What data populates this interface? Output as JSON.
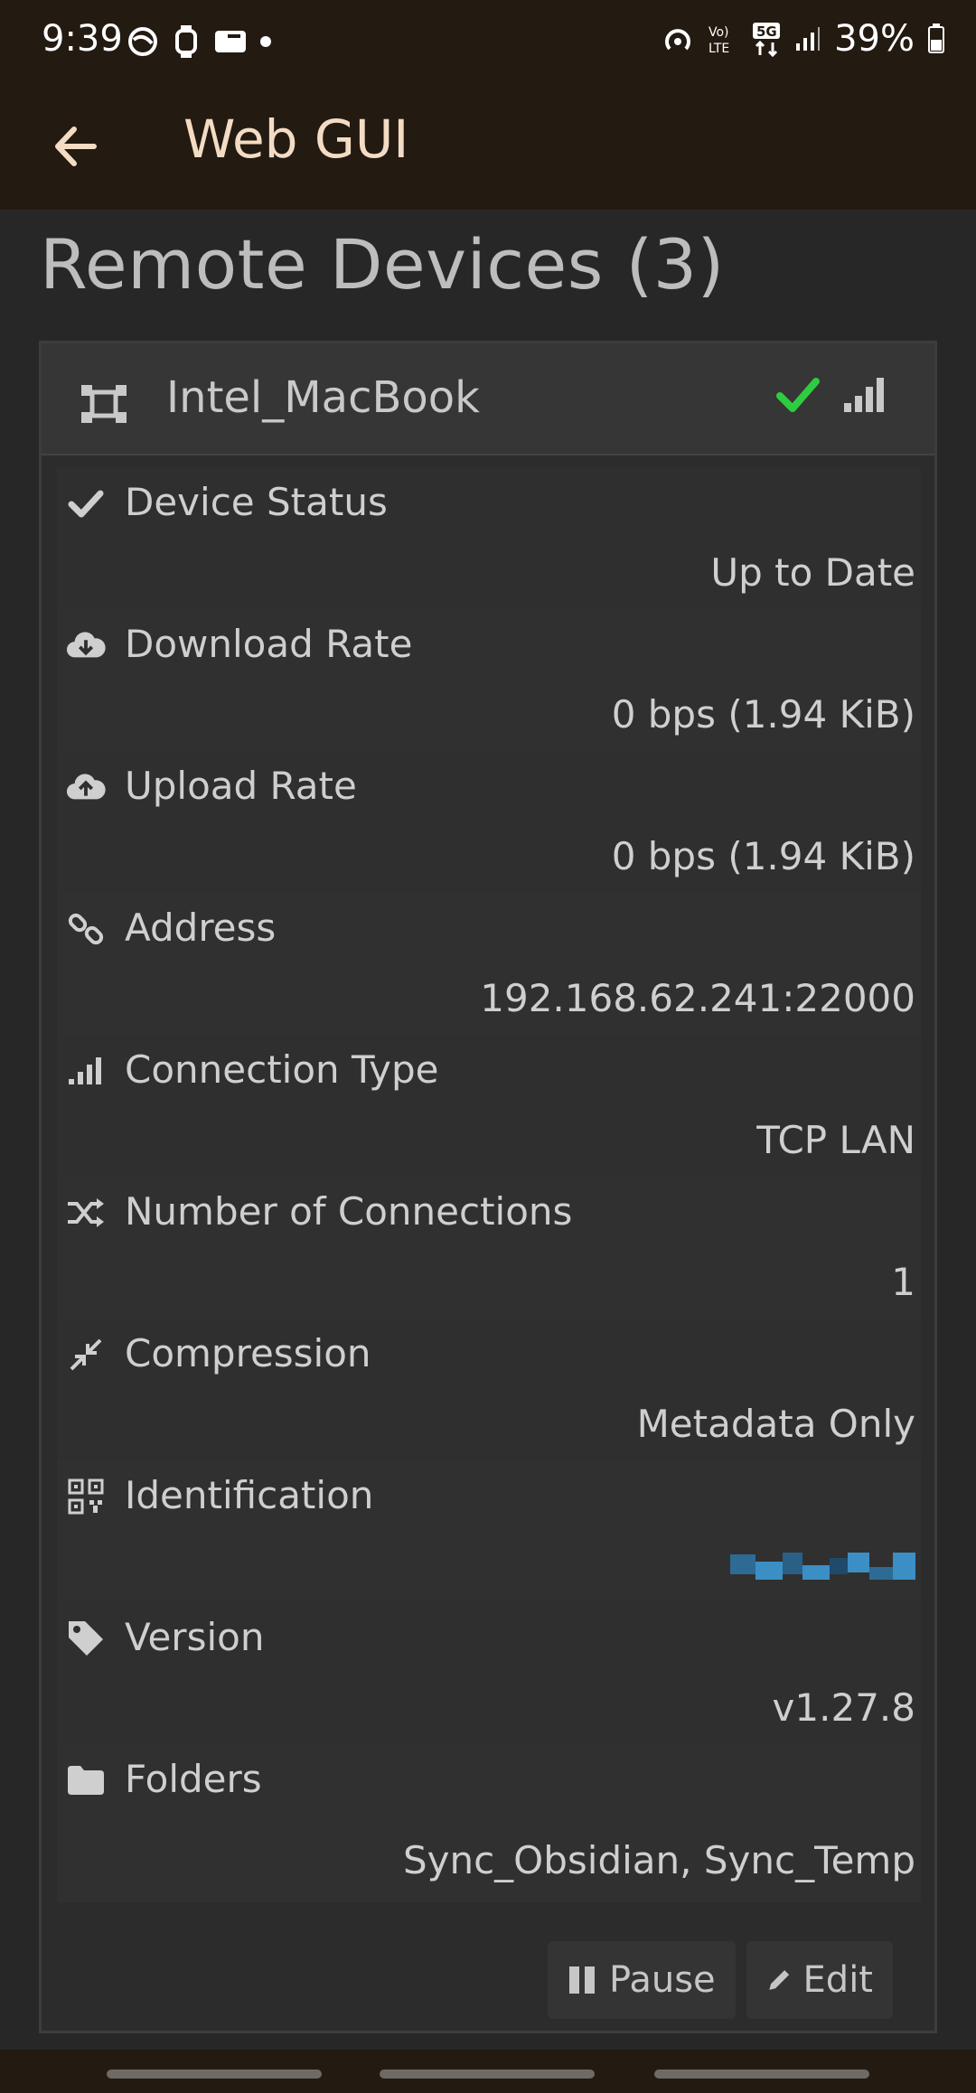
{
  "status_bar": {
    "time": "9:39",
    "battery": "39%",
    "left_icons": [
      "blob-icon",
      "watch-icon",
      "phone-icon",
      "dot-icon"
    ],
    "right_icons": [
      "hotspot-icon",
      "volte-icon",
      "5g-icon",
      "signal-icon",
      "battery-icon"
    ]
  },
  "app_bar": {
    "title": "Web GUI"
  },
  "page": {
    "title": "Remote Devices (3)"
  },
  "device": {
    "name": "Intel_MacBook",
    "accent_check": "#2ecc40",
    "rows": [
      {
        "icon": "check-icon",
        "label": "Device Status",
        "value": "Up to Date"
      },
      {
        "icon": "cloud-download-icon",
        "label": "Download Rate",
        "value": "0 bps (1.94 KiB)"
      },
      {
        "icon": "cloud-upload-icon",
        "label": "Upload Rate",
        "value": "0 bps (1.94 KiB)"
      },
      {
        "icon": "link-icon",
        "label": "Address",
        "value": "192.168.62.241:22000"
      },
      {
        "icon": "signal-icon",
        "label": "Connection Type",
        "value": "TCP LAN"
      },
      {
        "icon": "shuffle-icon",
        "label": "Number of Connections",
        "value": "1"
      },
      {
        "icon": "compress-icon",
        "label": "Compression",
        "value": "Metadata Only"
      },
      {
        "icon": "qrcode-icon",
        "label": "Identification",
        "value": ""
      },
      {
        "icon": "tag-icon",
        "label": "Version",
        "value": "v1.27.8"
      },
      {
        "icon": "folder-icon",
        "label": "Folders",
        "value": "Sync_Obsidian, Sync_Temp"
      }
    ],
    "buttons": {
      "pause": "Pause",
      "edit": "Edit"
    }
  }
}
